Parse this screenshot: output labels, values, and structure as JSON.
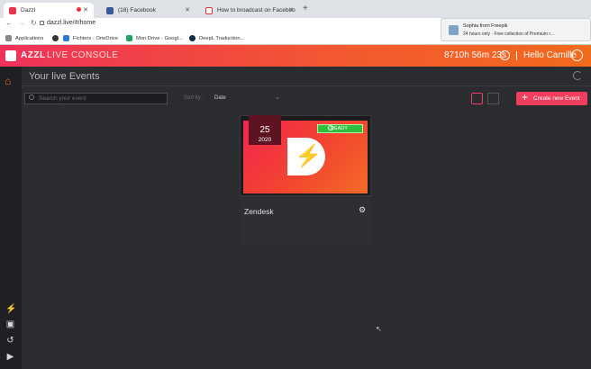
{
  "browser": {
    "tabs": [
      {
        "label": "Dazzl",
        "active": true
      },
      {
        "label": "(18) Facebook",
        "active": false
      },
      {
        "label": "How to broadcast on Faceboo",
        "active": false
      }
    ],
    "url": "dazzl.live/#/home",
    "bookmarks": [
      "Applications",
      "Fichiers - OneDrive",
      "Mon Drive - Googl...",
      "DeepL Traduction..."
    ],
    "notification": {
      "title": "Sophia from Freepik",
      "body": "24 hours only · Free collection of Premium r..."
    }
  },
  "app": {
    "brand": "AZZL",
    "brand_sub": "LIVE CONSOLE",
    "timer": "8710h 56m 23s",
    "greeting": "Hello Camille"
  },
  "main": {
    "title": "Your live Events",
    "search_placeholder": "Search your event",
    "sort_label": "Sort by :",
    "sort_value": "Date",
    "create_label": "Create new Event"
  },
  "event": {
    "day": "25",
    "year": "2020",
    "status": "READY",
    "name": "Zendesk"
  },
  "colors": {
    "accent": "#ef3e5e",
    "header_gradient_start": "#f0315a",
    "header_gradient_end": "#f26a1c",
    "ready": "#2fbf3f"
  }
}
